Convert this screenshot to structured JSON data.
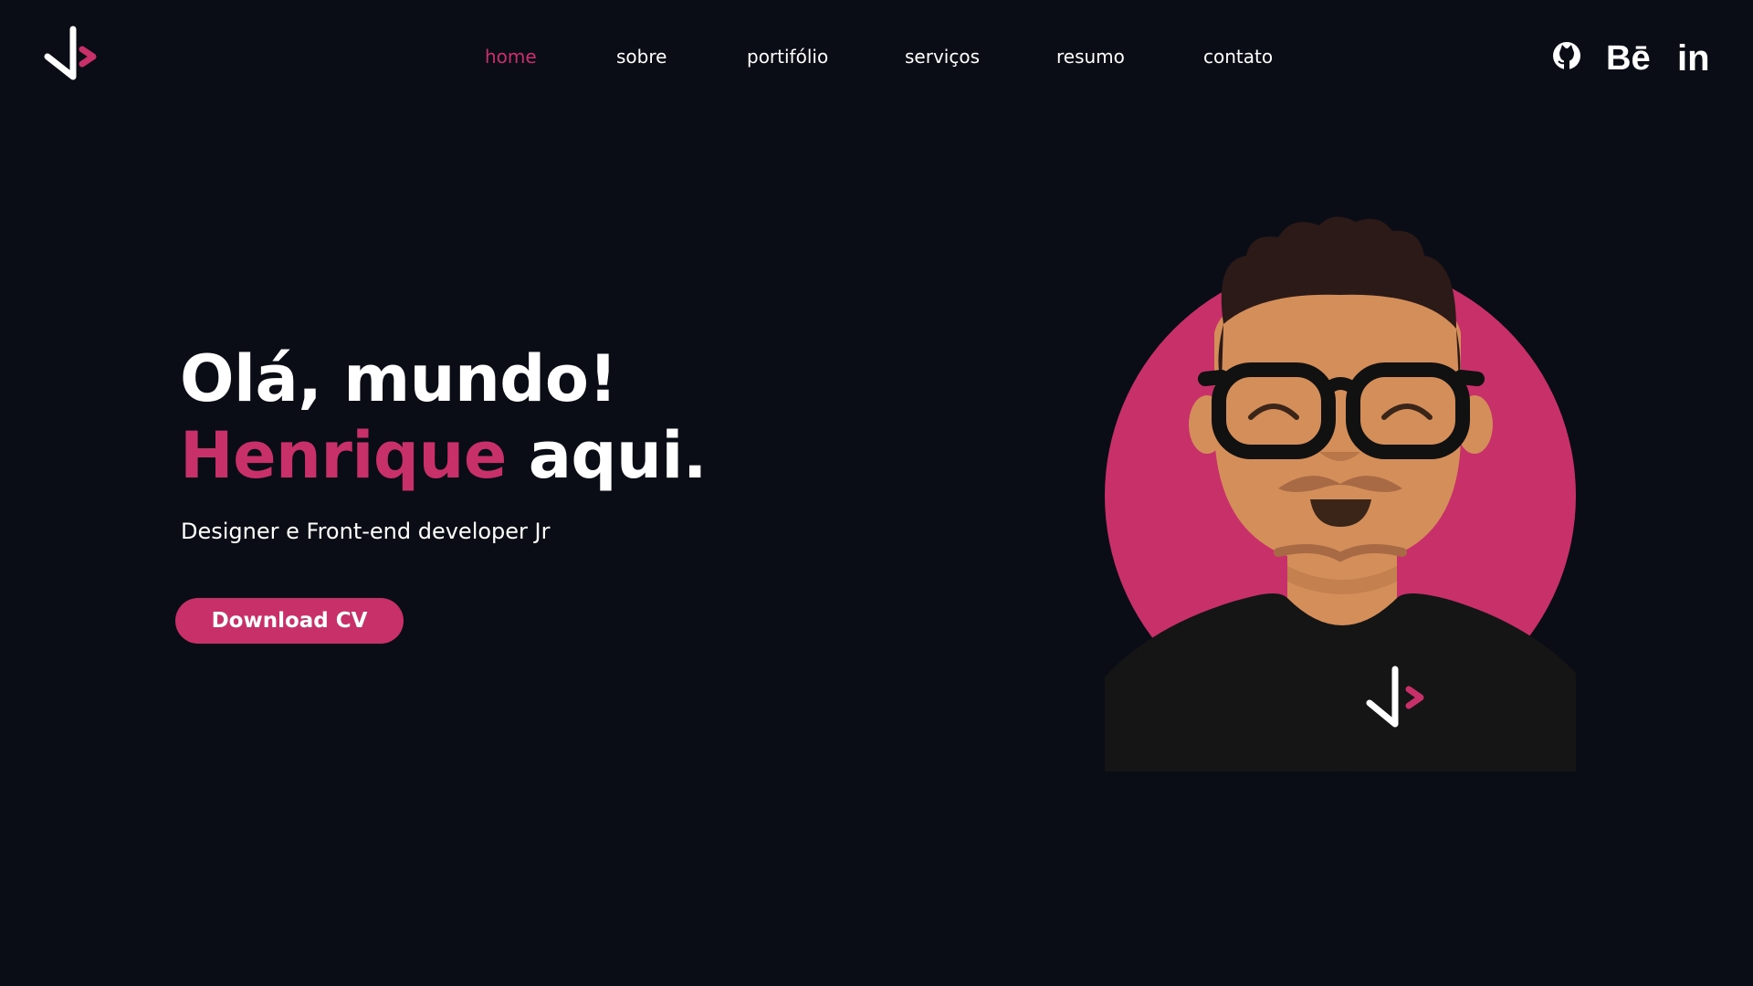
{
  "colors": {
    "background": "#0a0d15",
    "accent": "#c8306a",
    "text": "#ffffff"
  },
  "header": {
    "logo_icon": "code-check-logo-icon",
    "nav": [
      {
        "label": "home",
        "active": true
      },
      {
        "label": "sobre",
        "active": false
      },
      {
        "label": "portifólio",
        "active": false
      },
      {
        "label": "serviços",
        "active": false
      },
      {
        "label": "resumo",
        "active": false
      },
      {
        "label": "contato",
        "active": false
      }
    ],
    "social": [
      {
        "icon": "github-icon"
      },
      {
        "icon": "behance-icon"
      },
      {
        "icon": "linkedin-icon"
      }
    ]
  },
  "hero": {
    "greeting": "Olá, mundo!",
    "name": "Henrique",
    "name_suffix": " aqui.",
    "subtitle": "Designer e Front-end developer Jr",
    "cta_label": "Download CV",
    "avatar_icon": "developer-avatar-illustration"
  }
}
